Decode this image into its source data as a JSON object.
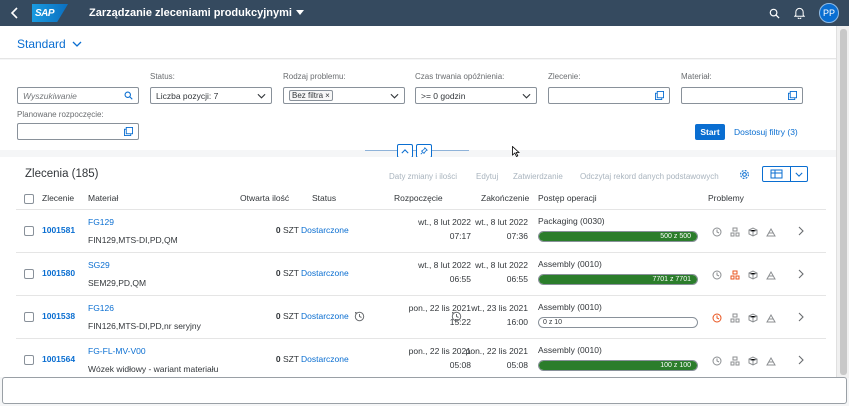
{
  "shell": {
    "logo": "SAP",
    "title": "Zarządzanie zleceniami produkcyjnymi",
    "avatar": "PP"
  },
  "variant": {
    "name": "Standard"
  },
  "filters": {
    "search": {
      "placeholder": "Wyszukiwanie"
    },
    "status": {
      "label": "Status:",
      "value": "Liczba pozycji: 7"
    },
    "problem": {
      "label": "Rodzaj problemu:",
      "token": "Bez filtra"
    },
    "delay": {
      "label": "Czas trwania opóźnienia:",
      "value": ">= 0 godzin"
    },
    "order": {
      "label": "Zlecenie:"
    },
    "material": {
      "label": "Materiał:"
    },
    "planned": {
      "label": "Planowane rozpoczęcie:"
    },
    "start_label": "Start",
    "adapt_label": "Dostosuj filtry (3)"
  },
  "table": {
    "title": "Zlecenia (185)",
    "toolbar": {
      "quantity_changes": "Daty zmiany i ilości",
      "edit": "Edytuj",
      "approve": "Zatwierdzanie",
      "refresh": "Odczytaj rekord danych podstawowych"
    },
    "columns": {
      "order": "Zlecenie",
      "material": "Materiał",
      "open_qty": "Otwarta ilość",
      "status": "Status",
      "start": "Rozpoczęcie",
      "end": "Zakończenie",
      "progress": "Postęp operacji",
      "issues": "Problemy"
    },
    "rows": [
      {
        "order": "1001581",
        "material": "FG129",
        "material_desc": "FIN129,MTS-DI,PD,QM",
        "qty": "0",
        "unit": "SZT",
        "status": "Dostarczone",
        "start_date": "wt., 8 lut 2022",
        "start_time": "07:17",
        "end_date": "wt., 8 lut 2022",
        "end_time": "07:36",
        "operation": "Packaging (0030)",
        "progress_text": "500 z 500",
        "progress_pct": 100
      },
      {
        "order": "1001580",
        "material": "SG29",
        "material_desc": "SEM29,PD,QM",
        "qty": "0",
        "unit": "SZT",
        "status": "Dostarczone",
        "start_date": "wt., 8 lut 2022",
        "start_time": "06:55",
        "end_date": "wt., 8 lut 2022",
        "end_time": "06:55",
        "operation": "Assembly (0010)",
        "progress_text": "7701 z 7701",
        "progress_pct": 100
      },
      {
        "order": "1001538",
        "material": "FG126",
        "material_desc": "FIN126,MTS-DI,PD,nr seryjny",
        "qty": "0",
        "unit": "SZT",
        "status": "Dostarczone",
        "start_date": "pon., 22 lis 2021",
        "start_time": "15:22",
        "end_date": "wt., 23 lis 2021",
        "end_time": "16:00",
        "operation": "Assembly (0010)",
        "progress_text": "0 z 10",
        "progress_pct": 0
      },
      {
        "order": "1001564",
        "material": "FG-FL-MV-V00",
        "material_desc": "Wózek widłowy - wariant materiału",
        "qty": "0",
        "unit": "SZT",
        "status": "Dostarczone",
        "start_date": "pon., 22 lis 2021",
        "start_time": "05:08",
        "end_date": "pon., 22 lis 2021",
        "end_time": "05:08",
        "operation": "Assembly (0010)",
        "progress_text": "100 z 100",
        "progress_pct": 100
      }
    ]
  },
  "colors": {
    "shell": "#354a5f",
    "accent": "#0a6ed1",
    "progress": "#2b7d2b",
    "alert": "#e9541f"
  }
}
